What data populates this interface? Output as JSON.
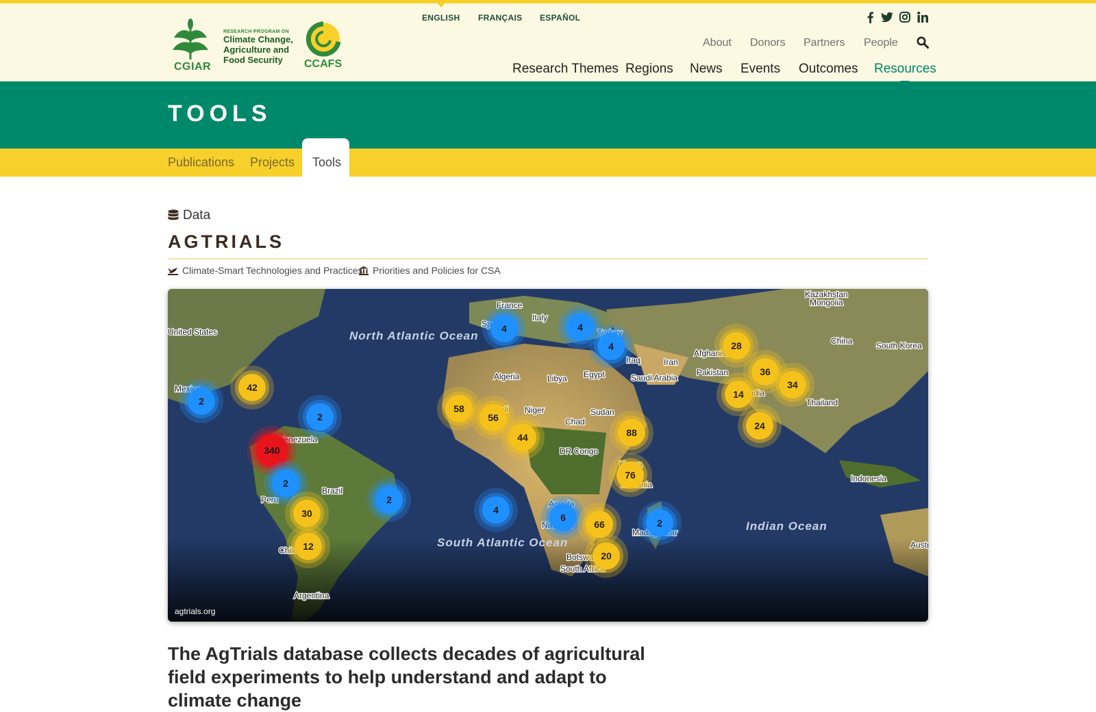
{
  "header": {
    "logo": {
      "cgiar_text": "CGIAR",
      "program_small": "RESEARCH PROGRAM ON",
      "program_lines": [
        "Climate Change,",
        "Agriculture and",
        "Food Security"
      ],
      "ccafs_text": "CCAFS"
    },
    "languages": [
      {
        "label": "ENGLISH",
        "active": true
      },
      {
        "label": "FRANÇAIS",
        "active": false
      },
      {
        "label": "ESPAÑOL",
        "active": false
      }
    ],
    "social_icons": [
      "facebook-icon",
      "twitter-icon",
      "instagram-icon",
      "linkedin-icon"
    ],
    "utility_nav": [
      "About",
      "Donors",
      "Partners",
      "People"
    ],
    "main_nav": [
      {
        "label": "Research Themes",
        "active": false
      },
      {
        "label": "Regions",
        "active": false
      },
      {
        "label": "News",
        "active": false
      },
      {
        "label": "Events",
        "active": false
      },
      {
        "label": "Outcomes",
        "active": false
      },
      {
        "label": "Resources",
        "active": true
      }
    ]
  },
  "hero": {
    "title": "TOOLS"
  },
  "subnav": {
    "tabs": [
      {
        "label": "Publications",
        "active": false
      },
      {
        "label": "Projects",
        "active": false
      },
      {
        "label": "Tools",
        "active": true
      }
    ]
  },
  "tool": {
    "type_label": "Data",
    "title": "AGTRIALS",
    "tags": [
      "Climate-Smart Technologies and Practices",
      "Priorities and Policies for CSA"
    ],
    "image_caption": "agtrials.org",
    "lede": "The AgTrials database collects decades of agricultural field experiments to help understand and adapt to climate change"
  },
  "map": {
    "labels": [
      "United States",
      "Mexico",
      "Venezuela",
      "Brazil",
      "Peru",
      "Chile",
      "Argentina",
      "North Atlantic Ocean",
      "South Atlantic Ocean",
      "Indian Ocean",
      "France",
      "Italy",
      "Spain",
      "Turkey",
      "Iraq",
      "Iran",
      "Algeria",
      "Libya",
      "Egypt",
      "Saudi Arabia",
      "Mali",
      "Niger",
      "Chad",
      "Sudan",
      "DR Congo",
      "Kenya",
      "Tanzania",
      "Angola",
      "Namibia",
      "Botswana",
      "South Africa",
      "Madagascar",
      "Afghanistan",
      "Pakistan",
      "India",
      "China",
      "Mongolia",
      "Kazakhstan",
      "South Korea",
      "Thailand",
      "Indonesia",
      "Australia"
    ],
    "clusters": [
      {
        "count": "2",
        "level": "low"
      },
      {
        "count": "42",
        "level": "mid"
      },
      {
        "count": "2",
        "level": "low"
      },
      {
        "count": "340",
        "level": "high"
      },
      {
        "count": "2",
        "level": "low"
      },
      {
        "count": "30",
        "level": "mid"
      },
      {
        "count": "12",
        "level": "mid"
      },
      {
        "count": "2",
        "level": "low"
      },
      {
        "count": "4",
        "level": "low"
      },
      {
        "count": "58",
        "level": "mid"
      },
      {
        "count": "56",
        "level": "mid"
      },
      {
        "count": "44",
        "level": "mid"
      },
      {
        "count": "4",
        "level": "low"
      },
      {
        "count": "4",
        "level": "low"
      },
      {
        "count": "4",
        "level": "low"
      },
      {
        "count": "88",
        "level": "mid"
      },
      {
        "count": "76",
        "level": "mid"
      },
      {
        "count": "6",
        "level": "low"
      },
      {
        "count": "66",
        "level": "mid"
      },
      {
        "count": "20",
        "level": "mid"
      },
      {
        "count": "2",
        "level": "low"
      },
      {
        "count": "28",
        "level": "mid"
      },
      {
        "count": "36",
        "level": "mid"
      },
      {
        "count": "34",
        "level": "mid"
      },
      {
        "count": "14",
        "level": "mid"
      },
      {
        "count": "24",
        "level": "mid"
      }
    ],
    "colors": {
      "low": "#1e90ff",
      "mid": "#f5c21b",
      "high": "#e8141b",
      "ocean": "#20345c",
      "land": "#8b7a4a"
    }
  }
}
